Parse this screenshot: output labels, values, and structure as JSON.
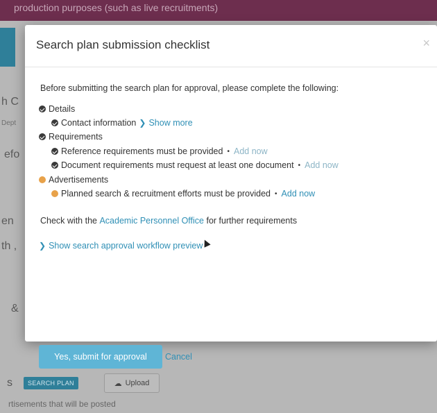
{
  "background": {
    "banner_text": "production purposes (such as live recruitments)",
    "fragments": [
      "h C",
      "efo",
      "en",
      "th ,",
      "&"
    ],
    "small_fragment": "Dept",
    "row": {
      "s": "s",
      "tag": "SEARCH PLAN",
      "upload": "Upload"
    },
    "footer_text": "rtisements that will be posted",
    "colors": {
      "banner": "#6d2e4e",
      "accent": "#2f7f99"
    }
  },
  "modal": {
    "title": "Search plan submission checklist",
    "close_icon": "×",
    "intro": "Before submitting the search plan for approval, please complete the following:",
    "items": {
      "details": "Details",
      "contact": "Contact information",
      "show_more": "Show more",
      "requirements": "Requirements",
      "reference_req": "Reference requirements must be provided",
      "reference_add": "Add now",
      "document_req": "Document requirements must request at least one document",
      "document_add": "Add now",
      "advertisements": "Advertisements",
      "planned_req": "Planned search & recruitment efforts must be provided",
      "planned_add": "Add now",
      "bullet": "•"
    },
    "office_pre": "Check with the",
    "office_link": "Academic Personnel Office",
    "office_post": "for further requirements",
    "workflow_link": "Show search approval workflow preview",
    "submit_label": "Yes, submit for approval",
    "cancel_label": "Cancel",
    "colors": {
      "link": "#2f8fb5",
      "warning_dot": "#e8a24a",
      "primary_button": "#5fb5d6"
    }
  }
}
